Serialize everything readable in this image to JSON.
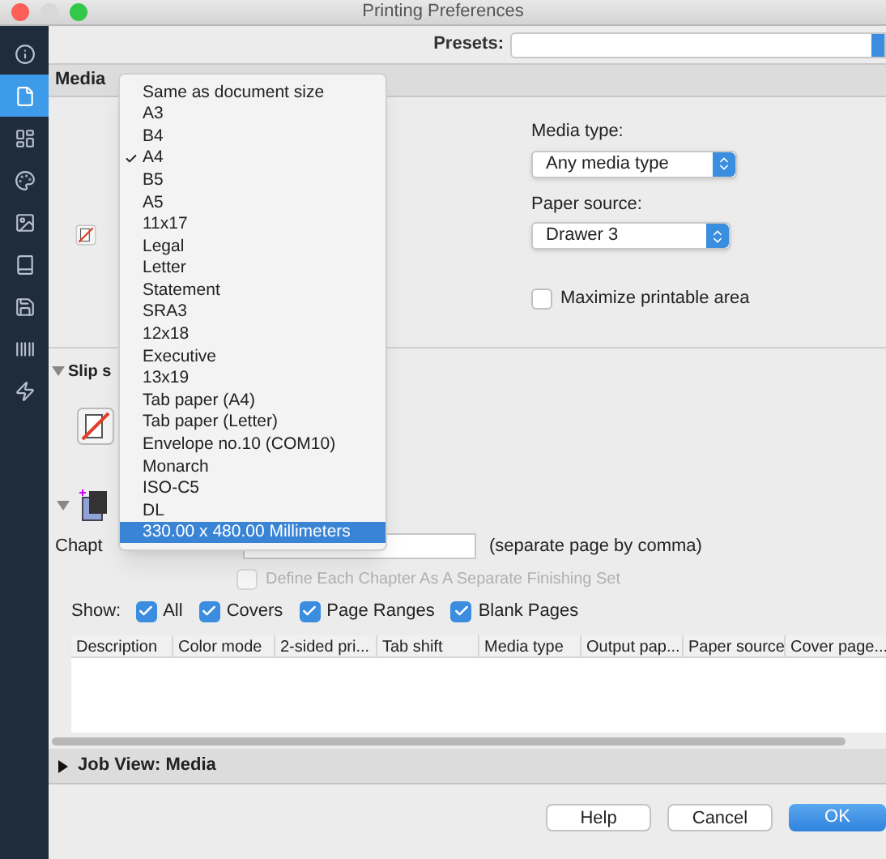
{
  "window": {
    "title": "Printing Preferences"
  },
  "sidebar": {
    "items": [
      {
        "kind": "info",
        "selected": false
      },
      {
        "kind": "page",
        "selected": true
      },
      {
        "kind": "layout",
        "selected": false
      },
      {
        "kind": "palette",
        "selected": false
      },
      {
        "kind": "image",
        "selected": false
      },
      {
        "kind": "book",
        "selected": false
      },
      {
        "kind": "save",
        "selected": false
      },
      {
        "kind": "barcode",
        "selected": false
      },
      {
        "kind": "bolt",
        "selected": false
      }
    ]
  },
  "presets": {
    "label": "Presets:"
  },
  "section_header": "Media",
  "media_type": {
    "label": "Media type:",
    "value": "Any media type"
  },
  "paper_source": {
    "label": "Paper source:",
    "value": "Drawer 3"
  },
  "maximize": {
    "label": "Maximize printable area",
    "checked": false
  },
  "slip_section": {
    "label": "Slip s",
    "expanded": true
  },
  "chapter_section": {
    "expanded": true
  },
  "chapter": {
    "label": "Chapt",
    "hint": "(separate page by comma)"
  },
  "define_chapter": {
    "label": "Define Each Chapter As A Separate Finishing Set",
    "checked": false,
    "disabled": true
  },
  "show": {
    "label": "Show:",
    "options": [
      {
        "label": "All",
        "checked": true
      },
      {
        "label": "Covers",
        "checked": true
      },
      {
        "label": "Page Ranges",
        "checked": true
      },
      {
        "label": "Blank Pages",
        "checked": true
      }
    ]
  },
  "table": {
    "columns": [
      "Description",
      "Color mode",
      "2-sided pri...",
      "Tab shift",
      "Media type",
      "Output pap...",
      "Paper source",
      "Cover page..."
    ]
  },
  "job_view": {
    "label": "Job View: Media",
    "expanded": false
  },
  "buttons": [
    {
      "label": "Help",
      "kind": "normal"
    },
    {
      "label": "Cancel",
      "kind": "normal"
    },
    {
      "label": "OK",
      "kind": "default"
    }
  ],
  "size_menu": {
    "items": [
      {
        "label": "Same as document size",
        "checked": false,
        "selected": false
      },
      {
        "label": "A3",
        "checked": false,
        "selected": false
      },
      {
        "label": "B4",
        "checked": false,
        "selected": false
      },
      {
        "label": "A4",
        "checked": true,
        "selected": false
      },
      {
        "label": "B5",
        "checked": false,
        "selected": false
      },
      {
        "label": "A5",
        "checked": false,
        "selected": false
      },
      {
        "label": "11x17",
        "checked": false,
        "selected": false
      },
      {
        "label": "Legal",
        "checked": false,
        "selected": false
      },
      {
        "label": "Letter",
        "checked": false,
        "selected": false
      },
      {
        "label": "Statement",
        "checked": false,
        "selected": false
      },
      {
        "label": "SRA3",
        "checked": false,
        "selected": false
      },
      {
        "label": "12x18",
        "checked": false,
        "selected": false
      },
      {
        "label": "Executive",
        "checked": false,
        "selected": false
      },
      {
        "label": "13x19",
        "checked": false,
        "selected": false
      },
      {
        "label": "Tab paper (A4)",
        "checked": false,
        "selected": false
      },
      {
        "label": "Tab paper (Letter)",
        "checked": false,
        "selected": false
      },
      {
        "label": "Envelope no.10 (COM10)",
        "checked": false,
        "selected": false
      },
      {
        "label": "Monarch",
        "checked": false,
        "selected": false
      },
      {
        "label": "ISO-C5",
        "checked": false,
        "selected": false
      },
      {
        "label": "DL",
        "checked": false,
        "selected": false
      },
      {
        "label": "330.00 x 480.00 Millimeters",
        "checked": false,
        "selected": true
      }
    ]
  }
}
